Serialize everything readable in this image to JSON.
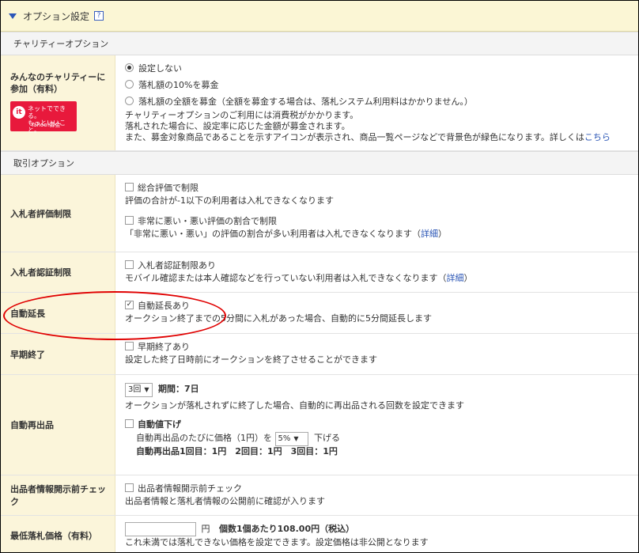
{
  "header": {
    "title": "オプション設定",
    "help": "?"
  },
  "charity": {
    "section": "チャリティーオプション",
    "label": "みんなのチャリティーに参加（有料）",
    "logo": {
      "text1": "ネットでできる。",
      "text2": "もっといいこと。",
      "sub": "Yahoo!募金",
      "mark": "it"
    },
    "options": [
      "設定しない",
      "落札額の10%を募金",
      "落札額の全額を募金（全額を募金する場合は、落札システム利用料はかかりません。）"
    ],
    "note1": "チャリティーオプションのご利用には消費税がかかります。",
    "note2": "落札された場合に、設定率に応じた金額が募金されます。",
    "note3": "また、募金対象商品であることを示すアイコンが表示され、商品一覧ページなどで背景色が緑色になります。詳しくは",
    "note3_link": "こちら"
  },
  "trade": {
    "section": "取引オプション",
    "bidder_rating": {
      "label": "入札者評価制限",
      "opt1": "総合評価で制限",
      "desc1": "評価の合計が-1以下の利用者は入札できなくなります",
      "opt2": "非常に悪い・悪い評価の割合で制限",
      "desc2": "「非常に悪い・悪い」の評価の割合が多い利用者は入札できなくなります（",
      "desc2_link": "詳細",
      "desc2_end": "）"
    },
    "bidder_auth": {
      "label": "入札者認証制限",
      "opt": "入札者認証制限あり",
      "desc": "モバイル確認または本人確認などを行っていない利用者は入札できなくなります（",
      "desc_link": "詳細",
      "desc_end": "）"
    },
    "auto_extend": {
      "label": "自動延長",
      "opt": "自動延長あり",
      "desc": "オークション終了までの5分間に入札があった場合、自動的に5分間延長します"
    },
    "early_end": {
      "label": "早期終了",
      "opt": "早期終了あり",
      "desc": "設定した終了日時前にオークションを終了させることができます"
    },
    "relist": {
      "label": "自動再出品",
      "count": "3回",
      "period": "期間：7日",
      "desc": "オークションが落札されずに終了した場合、自動的に再出品される回数を設定できます",
      "discount": "自動値下げ",
      "line_pre": "自動再出品のたびに価格（1円）を",
      "percent": "5%",
      "line_post": "下げる",
      "schedule": "自動再出品1回目：1円　2回目：1円　3回目：1円"
    },
    "seller_check": {
      "label": "出品者情報開示前チェック",
      "opt": "出品者情報開示前チェック",
      "desc": "出品者情報と落札者情報の公開前に確認が入ります"
    },
    "min_price": {
      "label": "最低落札価格（有料）",
      "unit": "円",
      "fee": "個数1個あたり108.00円（税込）",
      "desc": "これ未満では落札できない価格を設定できます。設定価格は非公開となります"
    }
  },
  "colors": {
    "accent_link": "#2a55b5",
    "label_bg": "#fbf5da",
    "highlight": "#e00000"
  }
}
